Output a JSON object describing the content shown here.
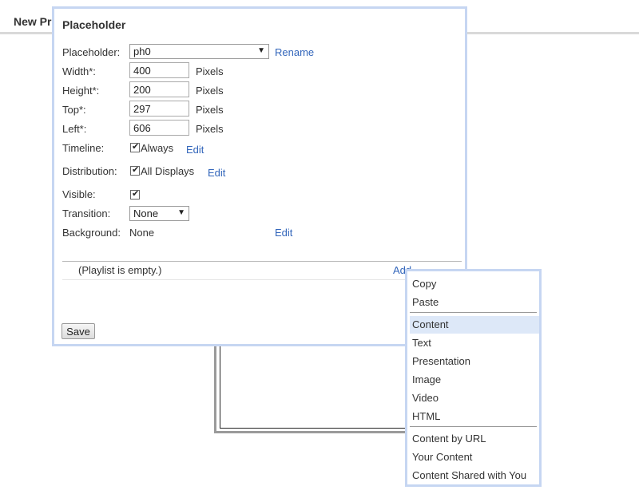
{
  "page": {
    "tab_title": "New Pr"
  },
  "dialog": {
    "title": "Placeholder",
    "placeholder": {
      "label": "Placeholder:",
      "value": "ph0",
      "rename": "Rename"
    },
    "width": {
      "label": "Width*:",
      "value": "400",
      "unit": "Pixels"
    },
    "height": {
      "label": "Height*:",
      "value": "200",
      "unit": "Pixels"
    },
    "top": {
      "label": "Top*:",
      "value": "297",
      "unit": "Pixels"
    },
    "left": {
      "label": "Left*:",
      "value": "606",
      "unit": "Pixels"
    },
    "timeline": {
      "label": "Timeline:",
      "option": "Always",
      "edit": "Edit"
    },
    "distribution": {
      "label": "Distribution:",
      "option": "All Displays",
      "edit": "Edit"
    },
    "visible": {
      "label": "Visible:"
    },
    "transition": {
      "label": "Transition:",
      "value": "None"
    },
    "background": {
      "label": "Background:",
      "value": "None",
      "edit": "Edit"
    },
    "playlist": {
      "empty_text": "(Playlist is empty.)",
      "add": "Add"
    },
    "save_label": "Save"
  },
  "context_menu": {
    "items": [
      "Copy",
      "Paste",
      "Content",
      "Text",
      "Presentation",
      "Image",
      "Video",
      "HTML",
      "Content by URL",
      "Your Content",
      "Content Shared with You"
    ],
    "highlighted": "Content"
  },
  "colors": {
    "accent_border": "#c6d6f2",
    "link": "#3366bb",
    "highlight": "#dde8f8"
  },
  "icons": {
    "dropdown": "chevron-down-icon",
    "check": "checkmark-icon"
  }
}
